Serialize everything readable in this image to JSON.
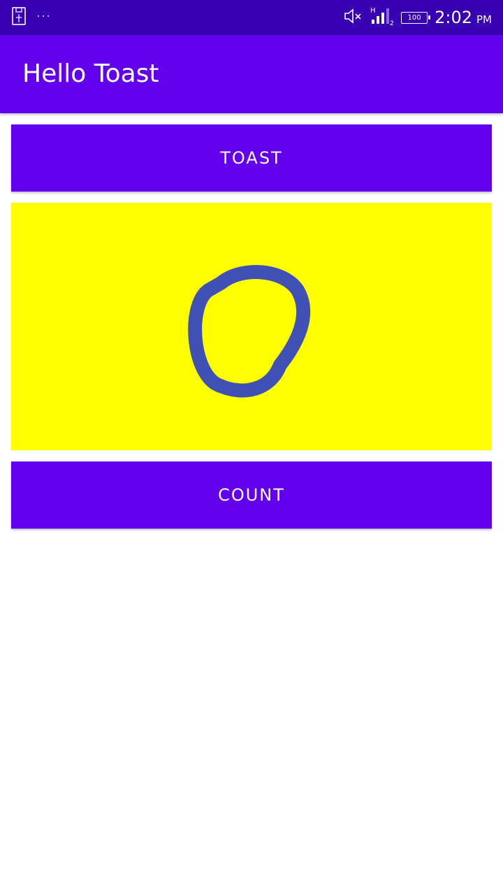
{
  "app": {
    "title": "Hello Toast"
  },
  "status_bar": {
    "time": "2:02",
    "ampm": "PM",
    "battery": "100",
    "signal_label": "H",
    "sim_label": "2",
    "icons": [
      "usb-icon",
      "more-dots-icon",
      "mute-icon",
      "signal-icon",
      "battery-icon"
    ]
  },
  "buttons": {
    "toast_label": "Toast",
    "count_label": "Count"
  },
  "counter": {
    "value": "0"
  },
  "colors": {
    "status_bar": "#3700b3",
    "primary": "#6200ee",
    "count_background": "#ffff00",
    "count_text": "#3f51b5"
  }
}
